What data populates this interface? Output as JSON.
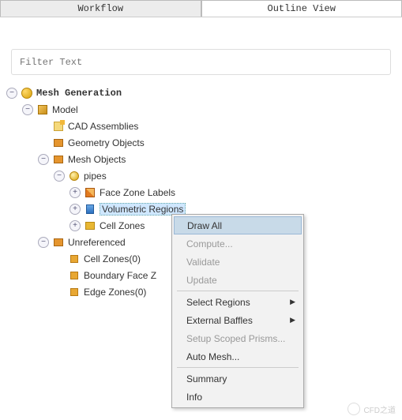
{
  "tabs": {
    "workflow": "Workflow",
    "outline": "Outline View"
  },
  "filter": {
    "placeholder": "Filter Text"
  },
  "tree": {
    "root": "Mesh Generation",
    "model": "Model",
    "cad": "CAD Assemblies",
    "geom": "Geometry Objects",
    "meshObj": "Mesh Objects",
    "pipes": "pipes",
    "faceZone": "Face Zone Labels",
    "volRegions": "Volumetric Regions",
    "cellZones": "Cell Zones",
    "unref": "Unreferenced",
    "cellZones0": "Cell Zones(0)",
    "boundaryFace": "Boundary Face Z",
    "edgeZones": "Edge Zones(0)"
  },
  "menu": {
    "drawAll": "Draw All",
    "compute": "Compute...",
    "validate": "Validate",
    "update": "Update",
    "selectRegions": "Select Regions",
    "externalBaffles": "External Baffles",
    "setupPrisms": "Setup Scoped Prisms...",
    "autoMesh": "Auto Mesh...",
    "summary": "Summary",
    "info": "Info"
  },
  "watermark": "CFD之道"
}
